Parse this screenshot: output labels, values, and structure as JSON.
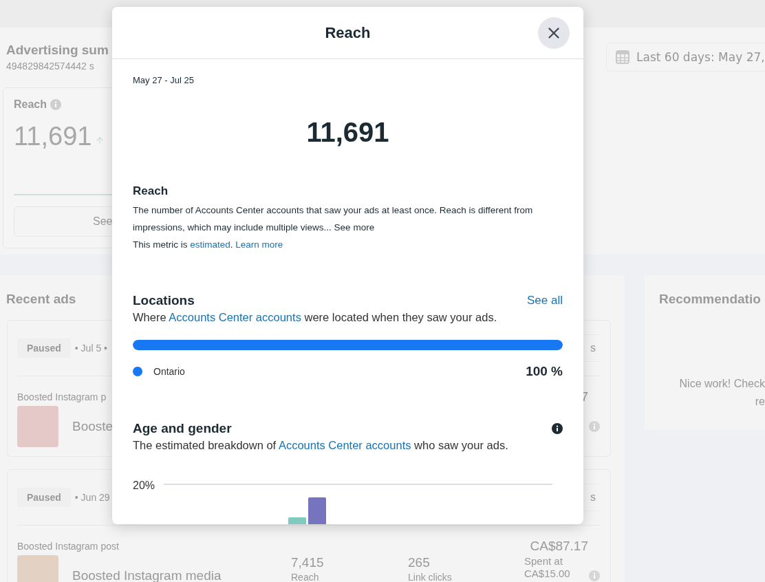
{
  "background": {
    "summary": {
      "title": "Advertising sum",
      "account": "494829842574442 s",
      "date_range": "Last 60 days: May 27,",
      "reach_card": {
        "label": "Reach",
        "value": "11,691",
        "button": "See"
      }
    },
    "recent_ads": {
      "title": "Recent ads",
      "ads": [
        {
          "status": "Paused",
          "date": "• Jul 5 •",
          "action": "s",
          "type": "Boosted Instagram p",
          "name": "Booste",
          "spend": "7"
        },
        {
          "status": "Paused",
          "date": "• Jun 29",
          "action": "s",
          "type": "Boosted Instagram post",
          "name": "Boosted Instagram media",
          "metrics": [
            {
              "value": "7,415",
              "label": "Reach"
            },
            {
              "value": "265",
              "label": "Link clicks"
            }
          ],
          "spend": "CA$87.17",
          "spend_note": "Spent at CA$15.00"
        }
      ]
    },
    "recommendations": {
      "title": "Recommendatio",
      "message": [
        "Nice work! Check",
        "re"
      ]
    }
  },
  "modal": {
    "title": "Reach",
    "date_range": "May 27 - Jul 25",
    "total": "11,691",
    "definition": {
      "title": "Reach",
      "text": "The number of Accounts Center accounts that saw your ads at least once. Reach is different from impressions, which may include multiple views... ",
      "see_more": "See more",
      "note": "This metric is ",
      "note_link": "estimated",
      "note_after": ". ",
      "learn_more": "Learn more"
    },
    "locations": {
      "title": "Locations",
      "see_all": "See all",
      "description": {
        "before": "Where ",
        "link": "Accounts Center accounts",
        "after": " were located when they saw your ads."
      },
      "items": [
        {
          "name": "Ontario",
          "share": "100 %",
          "level": 1,
          "color": "#1877f2"
        }
      ]
    },
    "age_gender": {
      "title": "Age and gender",
      "description": {
        "before": "The estimated breakdown of ",
        "link": "Accounts Center accounts",
        "after": " who saw your ads."
      },
      "axis_label": "20%"
    }
  }
}
